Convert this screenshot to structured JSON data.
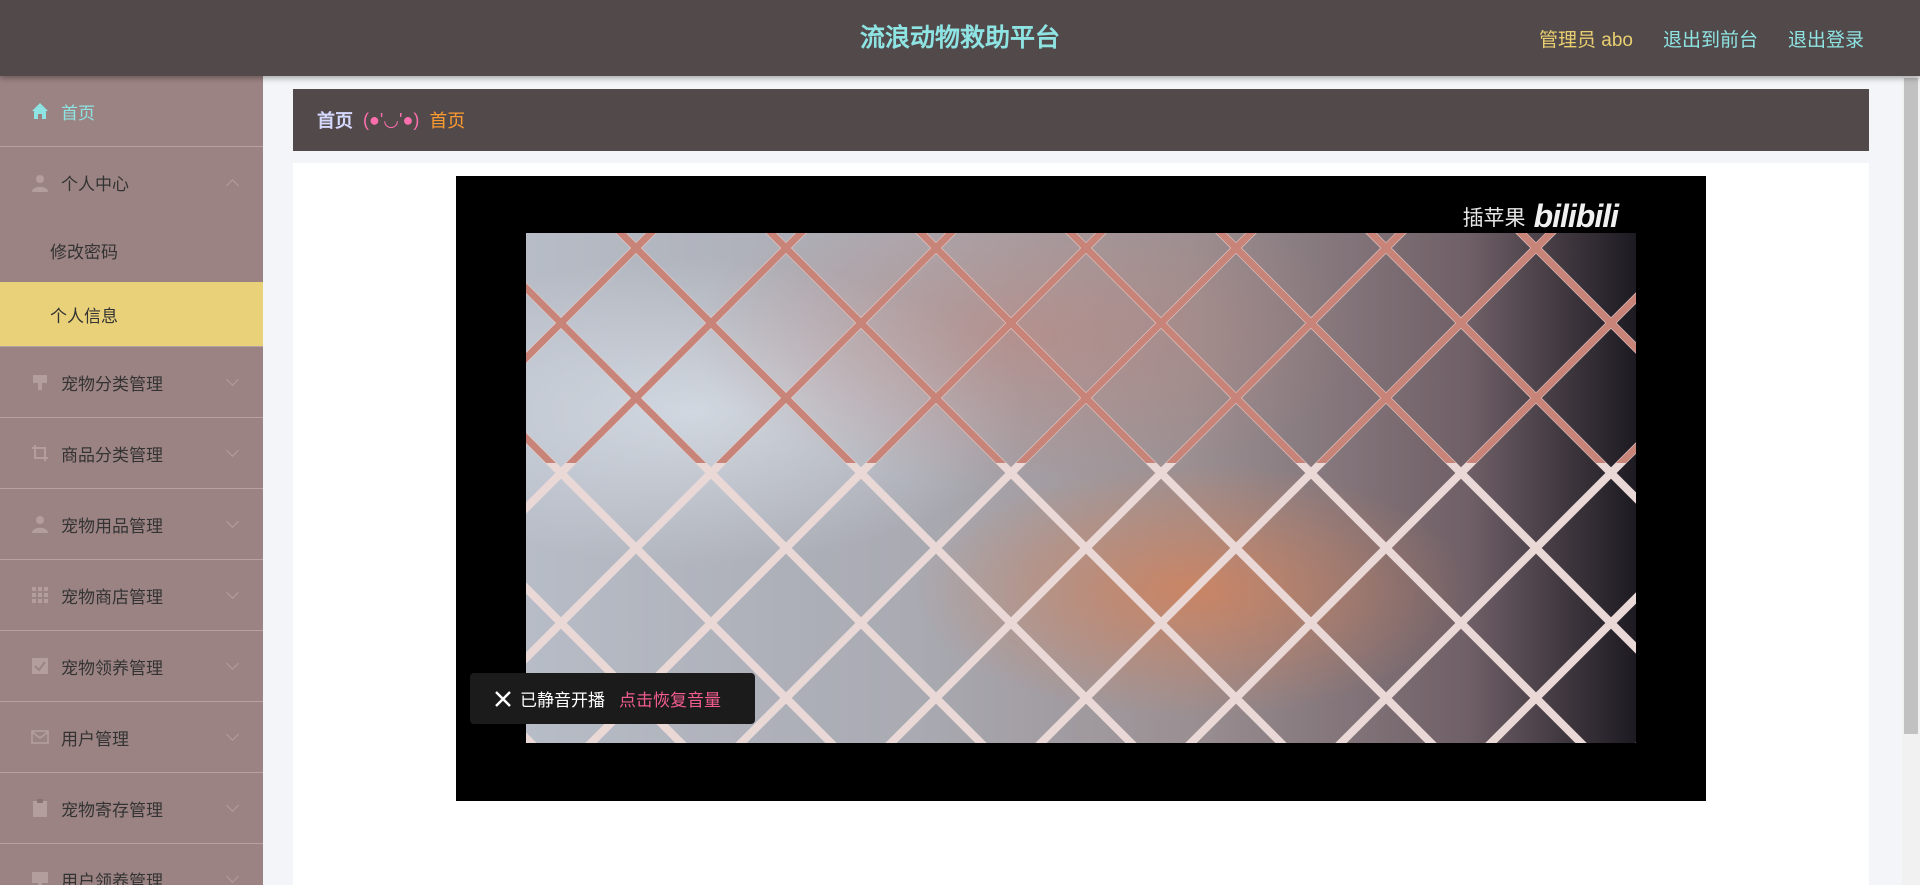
{
  "header": {
    "title": "流浪动物救助平台",
    "admin_label": "管理员 abo",
    "back_to_front": "退出到前台",
    "logout": "退出登录"
  },
  "sidebar": {
    "items": [
      {
        "label": "首页",
        "icon": "home-icon"
      },
      {
        "label": "个人中心",
        "icon": "user-icon",
        "expanded": true,
        "children": [
          {
            "label": "修改密码"
          },
          {
            "label": "个人信息",
            "active": true
          }
        ]
      },
      {
        "label": "宠物分类管理",
        "icon": "category-icon"
      },
      {
        "label": "商品分类管理",
        "icon": "crop-icon"
      },
      {
        "label": "宠物用品管理",
        "icon": "user-icon"
      },
      {
        "label": "宠物商店管理",
        "icon": "grid-icon"
      },
      {
        "label": "宠物领养管理",
        "icon": "checkbox-icon"
      },
      {
        "label": "用户管理",
        "icon": "mail-icon"
      },
      {
        "label": "宠物寄存管理",
        "icon": "clipboard-icon"
      },
      {
        "label": "用户领养管理",
        "icon": "monitor-icon"
      }
    ]
  },
  "breadcrumb": {
    "home": "首页",
    "separator": "(●'◡'●)",
    "current": "首页"
  },
  "video": {
    "watermark_text": "插苹果",
    "watermark_logo": "bilibili",
    "mute_message": "已静音开播",
    "restore_label": "点击恢复音量"
  },
  "colors": {
    "topbar": "#524a4a",
    "title": "#8ee3e3",
    "admin": "#e9cf6f",
    "sidebar": "#9c8383",
    "active_item": "#e9d17a",
    "breadcrumb_current": "#ff9a2e",
    "breadcrumb_separator": "#ff6fae",
    "restore_link": "#f25d8e"
  }
}
